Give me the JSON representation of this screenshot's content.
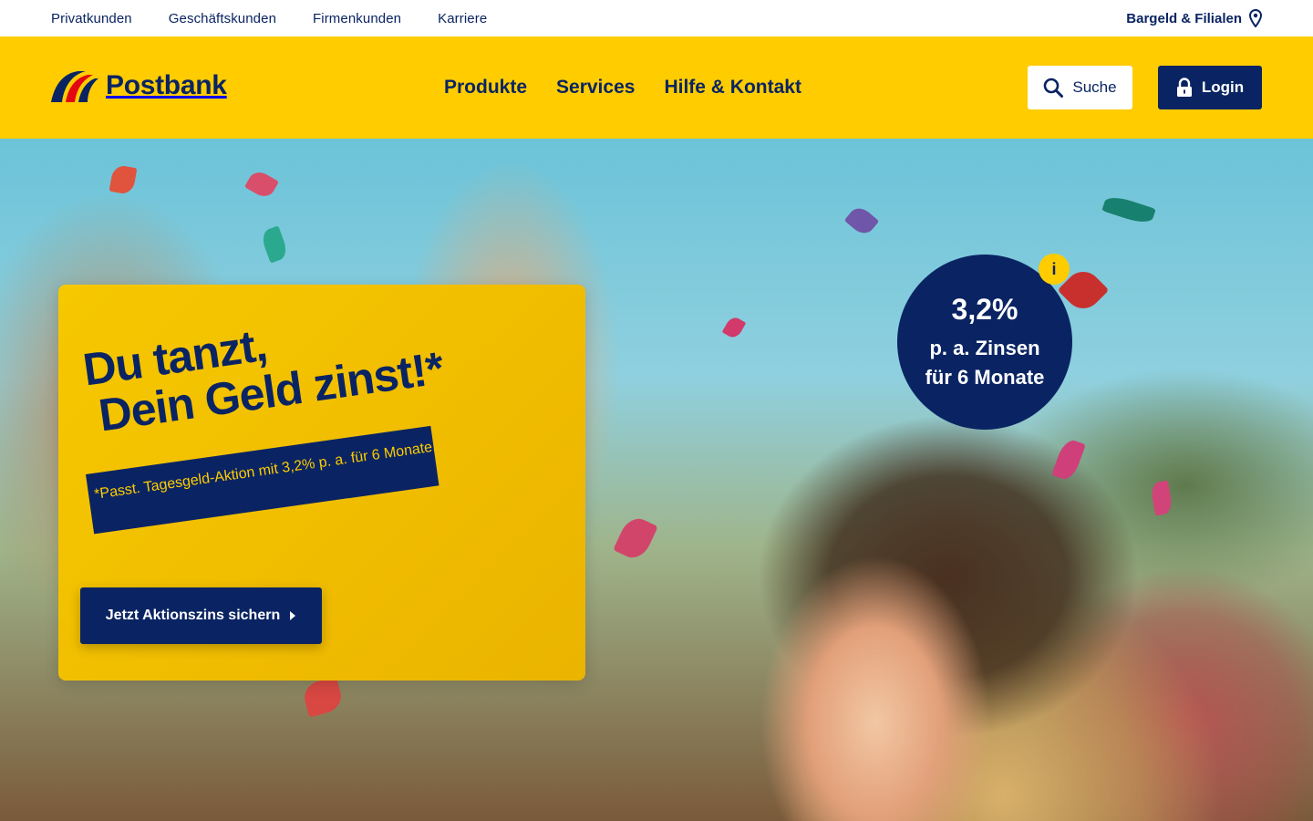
{
  "topbar": {
    "links": [
      "Privatkunden",
      "Geschäftskunden",
      "Firmenkunden",
      "Karriere"
    ],
    "branch_link": "Bargeld & Filialen"
  },
  "header": {
    "brand": "Postbank",
    "nav": [
      "Produkte",
      "Services",
      "Hilfe & Kontakt"
    ],
    "search_label": "Suche",
    "login_label": "Login"
  },
  "hero": {
    "badge": {
      "rate": "3,2%",
      "line1": "p. a. Zinsen",
      "line2": "für 6 Monate",
      "info": "i"
    },
    "headline_line1": "Du tanzt,",
    "headline_line2": "Dein Geld zinst!*",
    "footnote": "*Passt. Tagesgeld-Aktion mit 3,2% p. a. für 6 Monate.",
    "cta_label": "Jetzt Aktionszins sichern"
  },
  "colors": {
    "brand_yellow": "#ffcc00",
    "brand_blue": "#0a2463",
    "logo_red": "#e30613"
  },
  "icons": {
    "location": "map-pin-icon",
    "search": "search-icon",
    "lock": "lock-icon",
    "cta_arrow": "chevron-right-icon"
  }
}
